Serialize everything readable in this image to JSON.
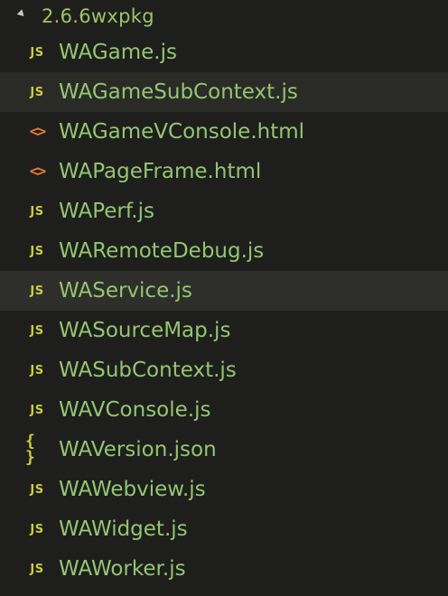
{
  "explorer": {
    "folder": {
      "name": "2.6.6wxpkg",
      "icon": "chevron-down-icon"
    },
    "files": [
      {
        "name": "WAGame.js",
        "type": "js",
        "icon_text": "JS",
        "state": "normal"
      },
      {
        "name": "WAGameSubContext.js",
        "type": "js",
        "icon_text": "JS",
        "state": "hover"
      },
      {
        "name": "WAGameVConsole.html",
        "type": "html",
        "icon_text": "<>",
        "state": "normal"
      },
      {
        "name": "WAPageFrame.html",
        "type": "html",
        "icon_text": "<>",
        "state": "normal"
      },
      {
        "name": "WAPerf.js",
        "type": "js",
        "icon_text": "JS",
        "state": "normal"
      },
      {
        "name": "WARemoteDebug.js",
        "type": "js",
        "icon_text": "JS",
        "state": "normal"
      },
      {
        "name": "WAService.js",
        "type": "js",
        "icon_text": "JS",
        "state": "selected"
      },
      {
        "name": "WASourceMap.js",
        "type": "js",
        "icon_text": "JS",
        "state": "normal"
      },
      {
        "name": "WASubContext.js",
        "type": "js",
        "icon_text": "JS",
        "state": "normal"
      },
      {
        "name": "WAVConsole.js",
        "type": "js",
        "icon_text": "JS",
        "state": "normal"
      },
      {
        "name": "WAVersion.json",
        "type": "json",
        "icon_text": "{ }",
        "state": "normal"
      },
      {
        "name": "WAWebview.js",
        "type": "js",
        "icon_text": "JS",
        "state": "normal"
      },
      {
        "name": "WAWidget.js",
        "type": "js",
        "icon_text": "JS",
        "state": "normal"
      },
      {
        "name": "WAWorker.js",
        "type": "js",
        "icon_text": "JS",
        "state": "normal"
      }
    ]
  },
  "colors": {
    "background": "#1e1f1c",
    "hover_row": "#2a2b27",
    "selected_row": "#2e2f2b",
    "file_name": "#93c572",
    "js_icon": "#cbcb41",
    "html_icon": "#e37933",
    "json_icon": "#cbcb41"
  }
}
